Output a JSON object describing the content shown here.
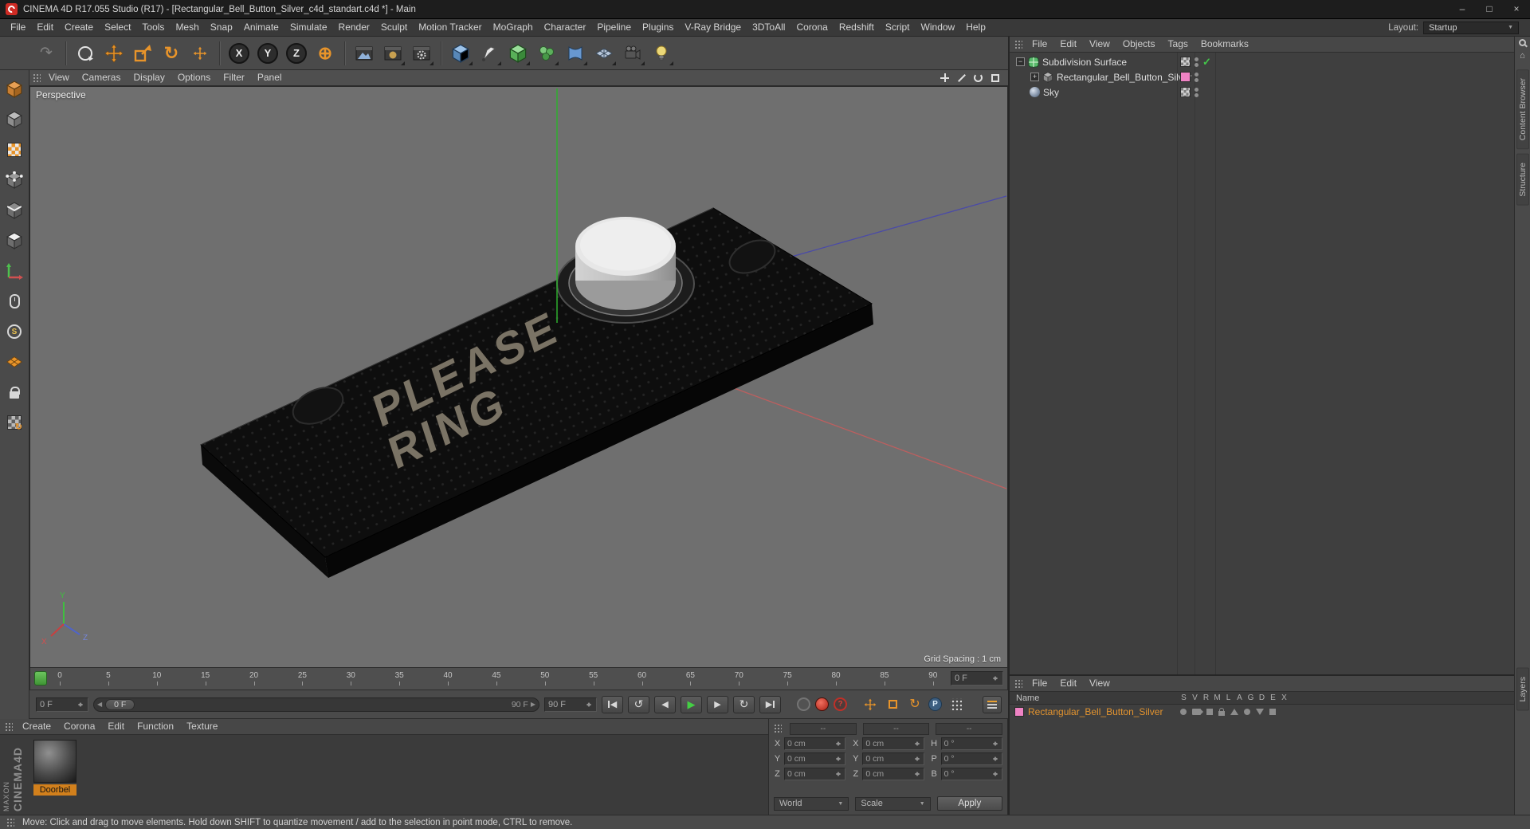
{
  "titlebar": {
    "title": "CINEMA 4D R17.055 Studio (R17) - [Rectangular_Bell_Button_Silver_c4d_standart.c4d *] - Main"
  },
  "window_controls": {
    "minimize": "–",
    "maximize": "□",
    "close": "×"
  },
  "menubar": {
    "items": [
      "File",
      "Edit",
      "Create",
      "Select",
      "Tools",
      "Mesh",
      "Snap",
      "Animate",
      "Simulate",
      "Render",
      "Sculpt",
      "Motion Tracker",
      "MoGraph",
      "Character",
      "Pipeline",
      "Plugins",
      "V-Ray Bridge",
      "3DToAll",
      "Corona",
      "Redshift",
      "Script",
      "Window",
      "Help"
    ],
    "layout_label": "Layout:",
    "layout_value": "Startup"
  },
  "toolbar": {
    "axis_x": "X",
    "axis_y": "Y",
    "axis_z": "Z"
  },
  "icons": {
    "undo": "↶",
    "redo": "↷",
    "rotate_tool": "↻",
    "coordinate_system": "⊕",
    "goto_start": "◀",
    "prev_key": "↺",
    "prev_frame": "◀",
    "play": "▶",
    "next_frame": "▶",
    "next_key": "↻",
    "goto_end": "▶",
    "record_rotation": "↻",
    "check": "✓",
    "caret": "▼",
    "expand_open": "−",
    "expand_closed": "+",
    "question": "?",
    "param": "P",
    "solo": "S",
    "tri_left": "◀",
    "tri_right": "▶"
  },
  "viewport": {
    "menu": [
      "View",
      "Cameras",
      "Display",
      "Options",
      "Filter",
      "Panel"
    ],
    "camera_label": "Perspective",
    "grid_spacing": "Grid Spacing : 1 cm",
    "plate_line1": "PLEASE",
    "plate_line2": "RING",
    "gizmo": {
      "x": "X",
      "y": "Y",
      "z": "Z"
    }
  },
  "object_manager": {
    "menu": [
      "File",
      "Edit",
      "View",
      "Objects",
      "Tags",
      "Bookmarks"
    ],
    "objects": [
      {
        "name": "Subdivision Surface"
      },
      {
        "name": "Rectangular_Bell_Button_Silver"
      },
      {
        "name": "Sky"
      }
    ]
  },
  "timeline": {
    "ticks": [
      "0",
      "5",
      "10",
      "15",
      "20",
      "25",
      "30",
      "35",
      "40",
      "45",
      "50",
      "55",
      "60",
      "65",
      "70",
      "75",
      "80",
      "85",
      "90"
    ],
    "frame_field": "0 F",
    "range_start": "0 F",
    "range_end": "90 F",
    "end_field": "90 F"
  },
  "materials": {
    "menu": [
      "Create",
      "Corona",
      "Edit",
      "Function",
      "Texture"
    ],
    "selected_material": "Doorbel"
  },
  "coordinates": {
    "headers": [
      "--",
      "--",
      "--"
    ],
    "position": [
      {
        "label": "X",
        "value": "0 cm"
      },
      {
        "label": "Y",
        "value": "0 cm"
      },
      {
        "label": "Z",
        "value": "0 cm"
      }
    ],
    "size": [
      {
        "label": "X",
        "value": "0 cm"
      },
      {
        "label": "Y",
        "value": "0 cm"
      },
      {
        "label": "Z",
        "value": "0 cm"
      }
    ],
    "rotation": [
      {
        "label": "H",
        "value": "0 °"
      },
      {
        "label": "P",
        "value": "0 °"
      },
      {
        "label": "B",
        "value": "0 °"
      }
    ],
    "world": "World",
    "scale": "Scale",
    "apply": "Apply"
  },
  "layers_panel": {
    "menu": [
      "File",
      "Edit",
      "View"
    ],
    "name_header": "Name",
    "columns": [
      "S",
      "V",
      "R",
      "M",
      "L",
      "A",
      "G",
      "D",
      "E",
      "X"
    ],
    "rows": [
      {
        "name": "Rectangular_Bell_Button_Silver"
      }
    ]
  },
  "side_tabs": {
    "upper": [
      "Content Browser",
      "Structure"
    ],
    "lower": [
      "Layers"
    ]
  },
  "statusbar": {
    "text": "Move: Click and drag to move elements. Hold down SHIFT to quantize movement / add to the selection in point mode, CTRL to remove."
  },
  "branding": {
    "maxon": "MAXON",
    "cinema": "CINEMA4D"
  }
}
